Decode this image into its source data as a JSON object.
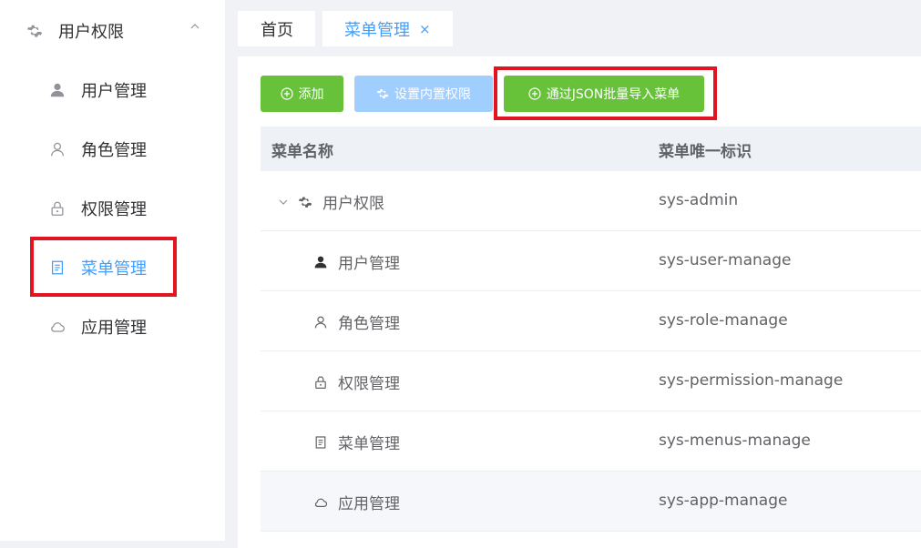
{
  "sidebar": {
    "parent": {
      "label": "用户权限",
      "icon": "gear-icon"
    },
    "items": [
      {
        "label": "用户管理",
        "icon": "user-filled-icon"
      },
      {
        "label": "角色管理",
        "icon": "user-outline-icon"
      },
      {
        "label": "权限管理",
        "icon": "lock-icon"
      },
      {
        "label": "菜单管理",
        "icon": "document-icon",
        "active": true
      },
      {
        "label": "应用管理",
        "icon": "cloud-icon"
      }
    ]
  },
  "tabs": [
    {
      "label": "首页"
    },
    {
      "label": "菜单管理",
      "active": true,
      "close": "×"
    }
  ],
  "toolbar": {
    "add_label": "添加",
    "set_label": "设置内置权限",
    "import_label": "通过JSON批量导入菜单"
  },
  "table": {
    "headers": [
      "菜单名称",
      "菜单唯一标识"
    ],
    "rows": [
      {
        "name": "用户权限",
        "key": "sys-admin",
        "icon": "gear-icon"
      },
      {
        "name": "用户管理",
        "key": "sys-user-manage",
        "icon": "user-filled-icon"
      },
      {
        "name": "角色管理",
        "key": "sys-role-manage",
        "icon": "user-outline-icon"
      },
      {
        "name": "权限管理",
        "key": "sys-permission-manage",
        "icon": "lock-icon"
      },
      {
        "name": "菜单管理",
        "key": "sys-menus-manage",
        "icon": "document-icon"
      },
      {
        "name": "应用管理",
        "key": "sys-app-manage",
        "icon": "cloud-icon"
      }
    ]
  },
  "colors": {
    "primary": "#409eff",
    "success": "#67c23a",
    "highlight": "#e0151f"
  }
}
